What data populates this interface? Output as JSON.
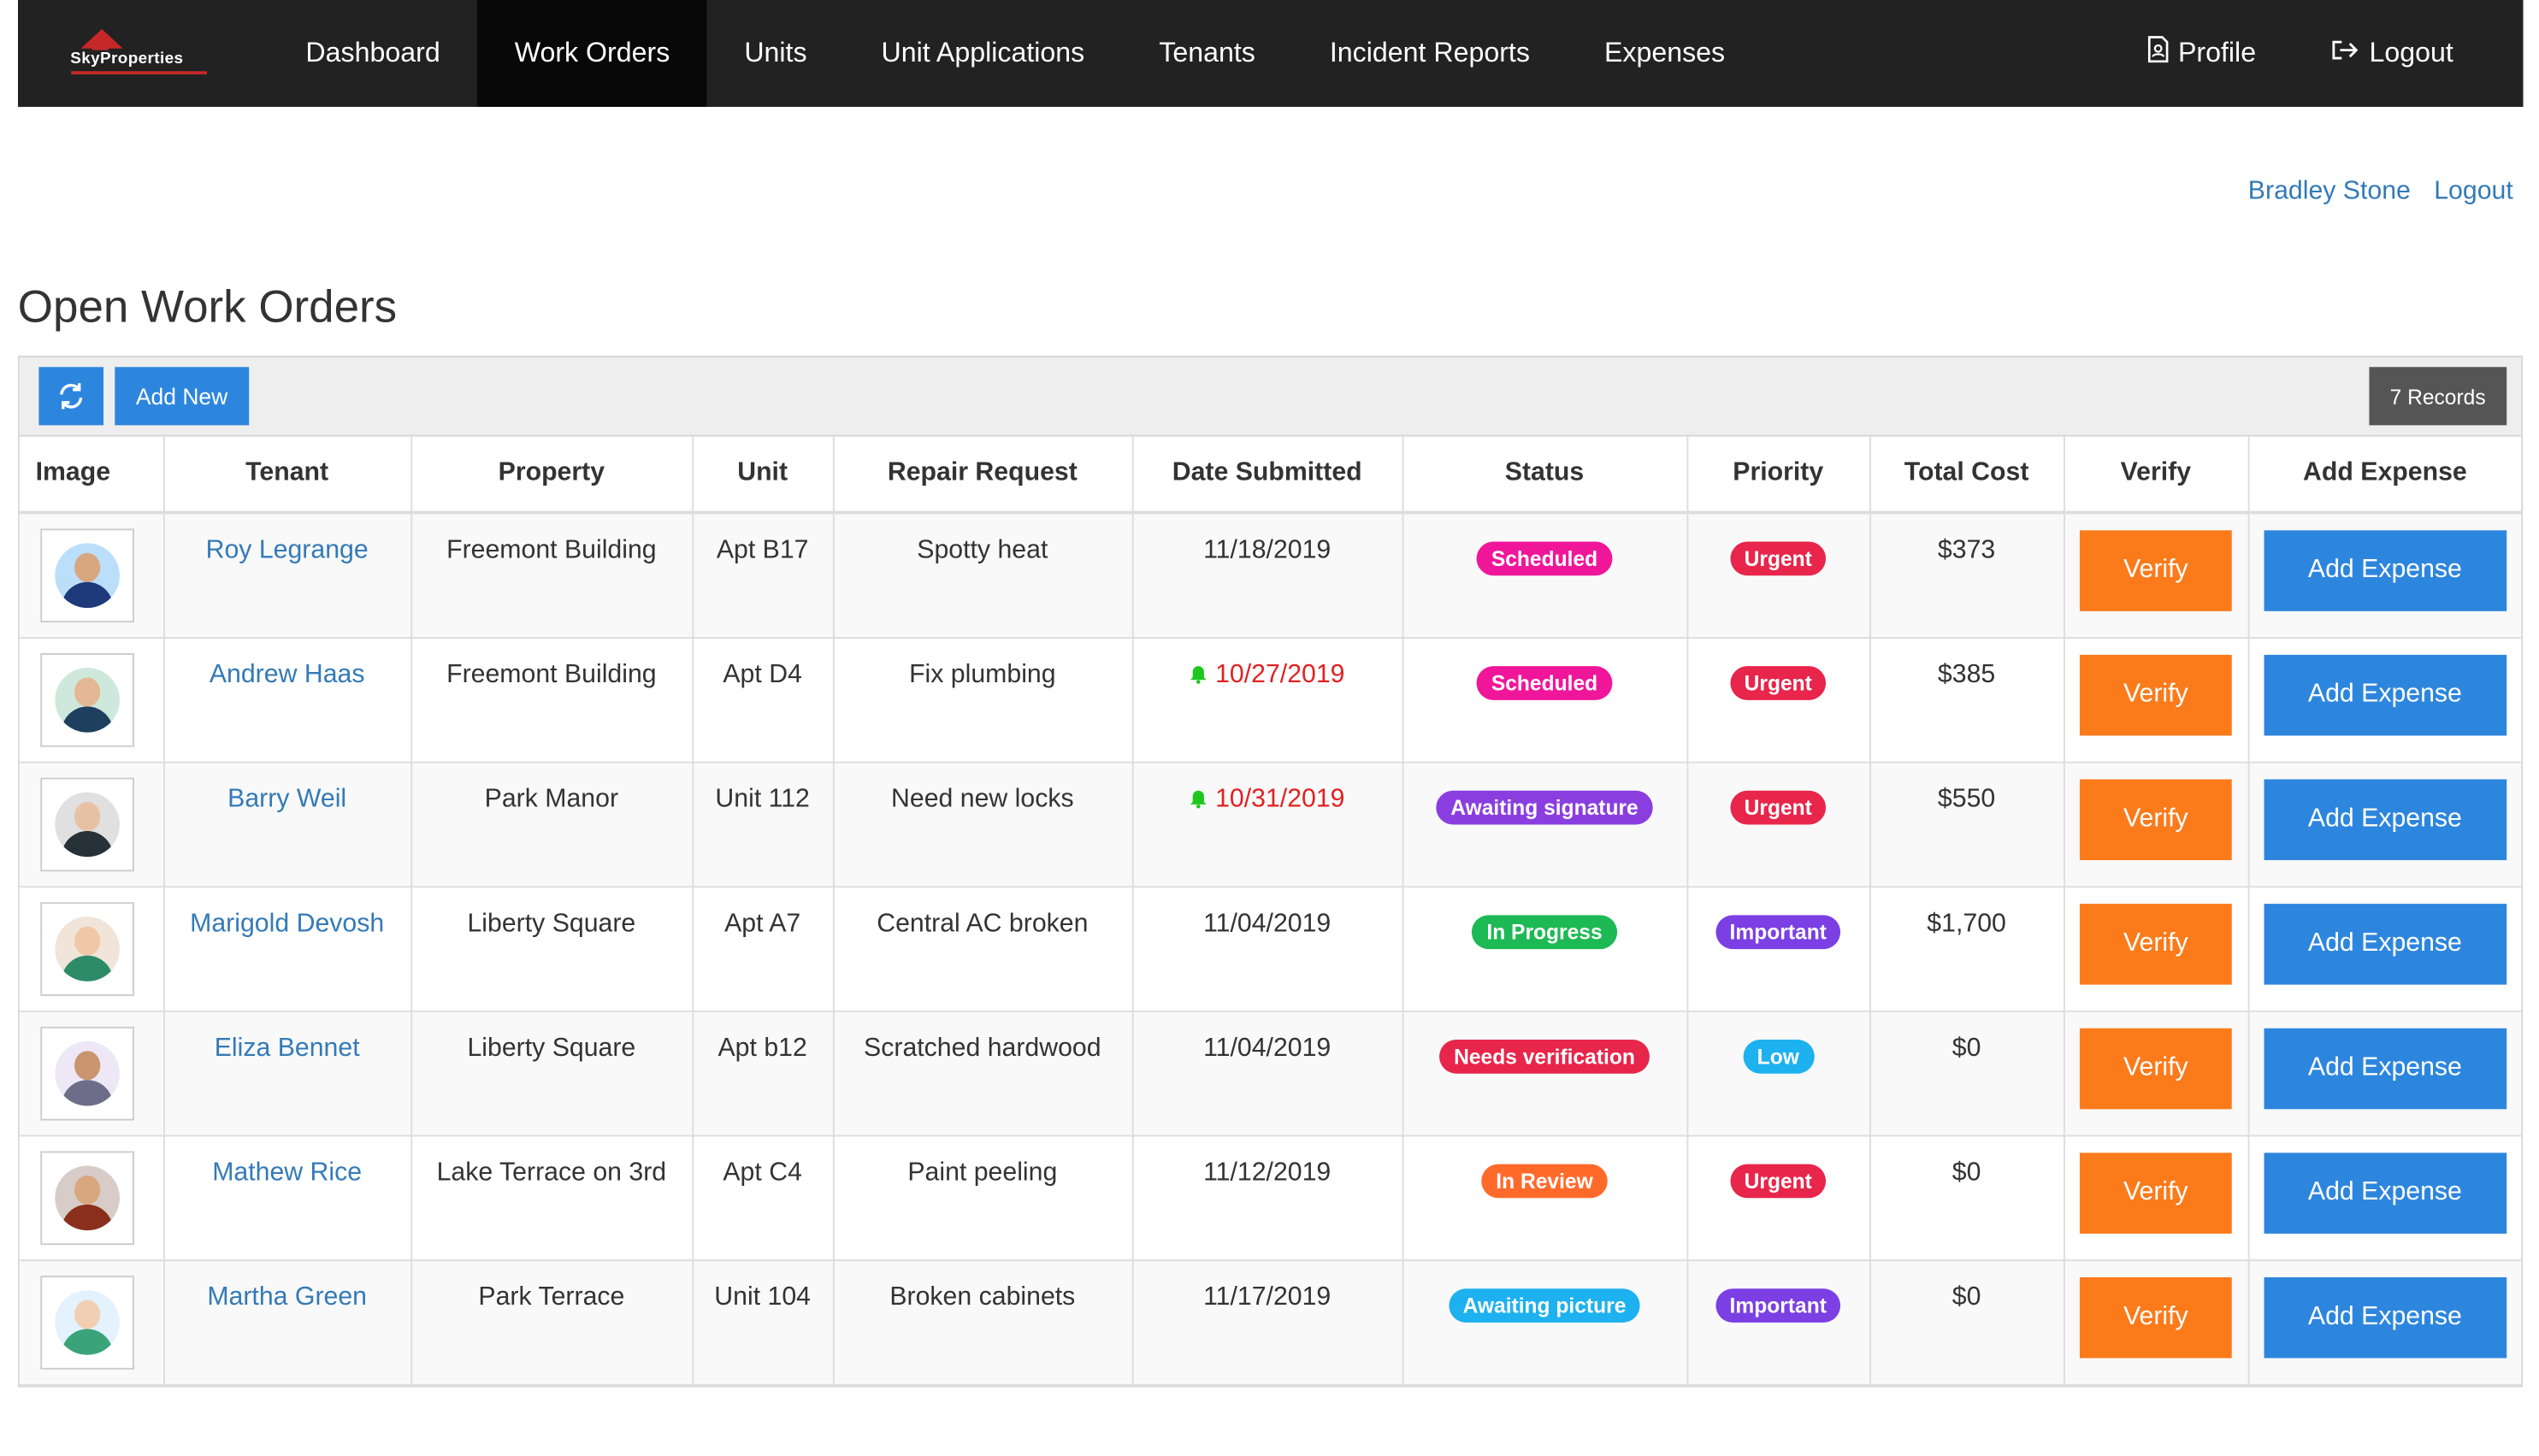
{
  "brand": {
    "name": "SkyProperties",
    "accent": "#c62828"
  },
  "nav": {
    "items": [
      {
        "label": "Dashboard",
        "active": false
      },
      {
        "label": "Work Orders",
        "active": true
      },
      {
        "label": "Units",
        "active": false
      },
      {
        "label": "Unit Applications",
        "active": false
      },
      {
        "label": "Tenants",
        "active": false
      },
      {
        "label": "Incident Reports",
        "active": false
      },
      {
        "label": "Expenses",
        "active": false
      }
    ],
    "profile_label": "Profile",
    "profile_icon": "profile-icon",
    "logout_label": "Logout",
    "logout_icon": "logout-icon"
  },
  "userbar": {
    "user_name": "Bradley Stone",
    "logout_label": "Logout"
  },
  "page": {
    "title": "Open Work Orders"
  },
  "toolbar": {
    "refresh_icon": "refresh-icon",
    "add_new_label": "Add New",
    "records_label": "7 Records"
  },
  "table": {
    "columns": [
      "Image",
      "Tenant",
      "Property",
      "Unit",
      "Repair Request",
      "Date Submitted",
      "Status",
      "Priority",
      "Total Cost",
      "Verify",
      "Add Expense"
    ],
    "rows": [
      {
        "tenant": "Roy Legrange",
        "property": "Freemont Building",
        "unit": "Apt B17",
        "request": "Spotty heat",
        "date": "11/18/2019",
        "late": false,
        "status": "Scheduled",
        "status_color": "#f0169a",
        "priority": "Urgent",
        "priority_color": "#e8254b",
        "cost": "$373",
        "verify": "Verify",
        "add_expense": "Add Expense",
        "avatar_bg": "#bbdefb",
        "avatar_body": "#1e3a7a",
        "avatar_skin": "#d9a77f"
      },
      {
        "tenant": "Andrew Haas",
        "property": "Freemont Building",
        "unit": "Apt D4",
        "request": "Fix plumbing",
        "date": "10/27/2019",
        "late": true,
        "status": "Scheduled",
        "status_color": "#f0169a",
        "priority": "Urgent",
        "priority_color": "#e8254b",
        "cost": "$385",
        "verify": "Verify",
        "add_expense": "Add Expense",
        "avatar_bg": "#cfe8dc",
        "avatar_body": "#1f3f5e",
        "avatar_skin": "#e4b894"
      },
      {
        "tenant": "Barry Weil",
        "property": "Park Manor",
        "unit": "Unit 112",
        "request": "Need new locks",
        "date": "10/31/2019",
        "late": true,
        "status": "Awaiting signature",
        "status_color": "#8a3ee0",
        "priority": "Urgent",
        "priority_color": "#e8254b",
        "cost": "$550",
        "verify": "Verify",
        "add_expense": "Add Expense",
        "avatar_bg": "#e0e0e0",
        "avatar_body": "#263238",
        "avatar_skin": "#e6c1a3"
      },
      {
        "tenant": "Marigold Devosh",
        "property": "Liberty Square",
        "unit": "Apt A7",
        "request": "Central AC broken",
        "date": "11/04/2019",
        "late": false,
        "status": "In Progress",
        "status_color": "#1db954",
        "priority": "Important",
        "priority_color": "#7b3fe4",
        "cost": "$1,700",
        "verify": "Verify",
        "add_expense": "Add Expense",
        "avatar_bg": "#f1e4d8",
        "avatar_body": "#2e8b6a",
        "avatar_skin": "#f0c8a8"
      },
      {
        "tenant": "Eliza Bennet",
        "property": "Liberty Square",
        "unit": "Apt b12",
        "request": "Scratched hardwood",
        "date": "11/04/2019",
        "late": false,
        "status": "Needs verification",
        "status_color": "#e8254b",
        "priority": "Low",
        "priority_color": "#1db1f0",
        "cost": "$0",
        "verify": "Verify",
        "add_expense": "Add Expense",
        "avatar_bg": "#ede7f6",
        "avatar_body": "#6d6d8a",
        "avatar_skin": "#c9956e"
      },
      {
        "tenant": "Mathew Rice",
        "property": "Lake Terrace on 3rd",
        "unit": "Apt C4",
        "request": "Paint peeling",
        "date": "11/12/2019",
        "late": false,
        "status": "In Review",
        "status_color": "#ff6a2b",
        "priority": "Urgent",
        "priority_color": "#e8254b",
        "cost": "$0",
        "verify": "Verify",
        "add_expense": "Add Expense",
        "avatar_bg": "#d7ccc8",
        "avatar_body": "#8a2f1c",
        "avatar_skin": "#d9a77f"
      },
      {
        "tenant": "Martha Green",
        "property": "Park Terrace",
        "unit": "Unit 104",
        "request": "Broken cabinets",
        "date": "11/17/2019",
        "late": false,
        "status": "Awaiting picture",
        "status_color": "#1db1f0",
        "priority": "Important",
        "priority_color": "#7b3fe4",
        "cost": "$0",
        "verify": "Verify",
        "add_expense": "Add Expense",
        "avatar_bg": "#e3f2fd",
        "avatar_body": "#3aa37a",
        "avatar_skin": "#f2cfb2"
      }
    ]
  },
  "colors": {
    "nav_bg": "#222222",
    "primary": "#2d86de",
    "verify": "#fb7a1a",
    "late_date": "#e02222",
    "bell": "#1ec71e"
  }
}
